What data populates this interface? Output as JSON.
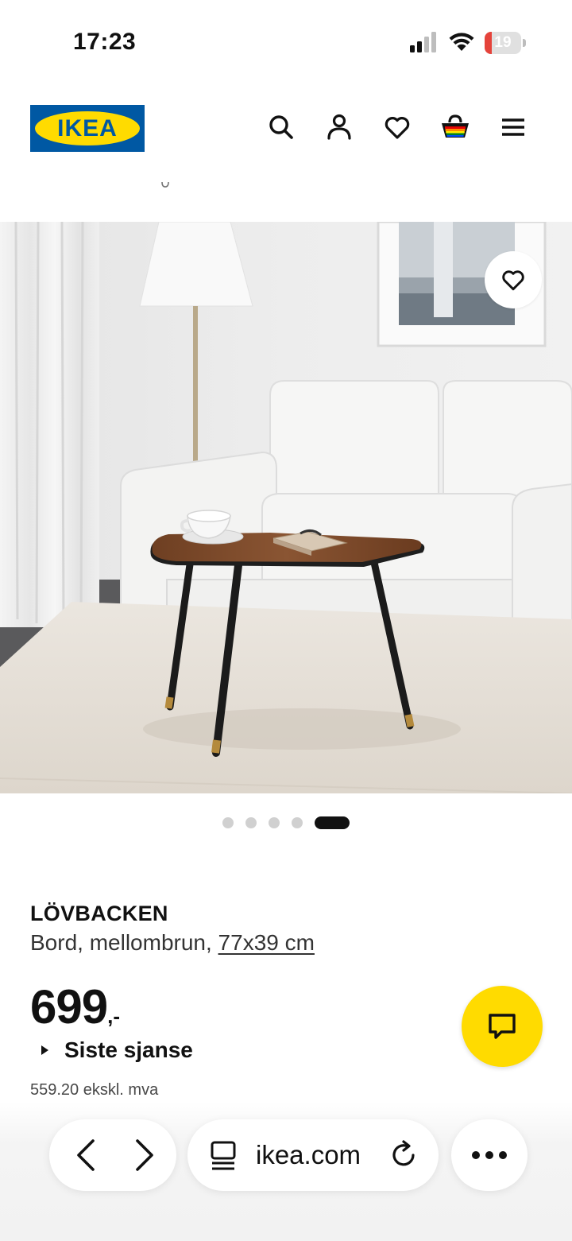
{
  "status_bar": {
    "time": "17:23",
    "battery": "19",
    "battery_level": 0.19,
    "icons": [
      "cellular-signal-icon",
      "wifi-icon",
      "battery-icon"
    ]
  },
  "header": {
    "logo_text": "IKEA",
    "icons": [
      "search-icon",
      "account-icon",
      "heart-icon",
      "shopping-bag-icon",
      "menu-icon"
    ]
  },
  "colors": {
    "ikea_blue": "#0058a3",
    "ikea_yellow": "#ffdb00",
    "battery_low": "#e5433b"
  },
  "gallery": {
    "image_count": 5,
    "active_index": 4,
    "wishlist_icon": "heart-icon"
  },
  "product": {
    "name": "LÖVBACKEN",
    "description": "Bord, mellombrun, ",
    "measure": "77x39 cm",
    "price": "699",
    "price_suffix": ",-",
    "label": "Siste sjanse",
    "ex_vat": "559.20 ekskl. mva"
  },
  "chat": {
    "icon": "chat-icon"
  },
  "browser": {
    "url": "ikea.com",
    "icons": [
      "back-icon",
      "forward-icon",
      "reader-icon",
      "reload-icon",
      "more-icon"
    ]
  }
}
